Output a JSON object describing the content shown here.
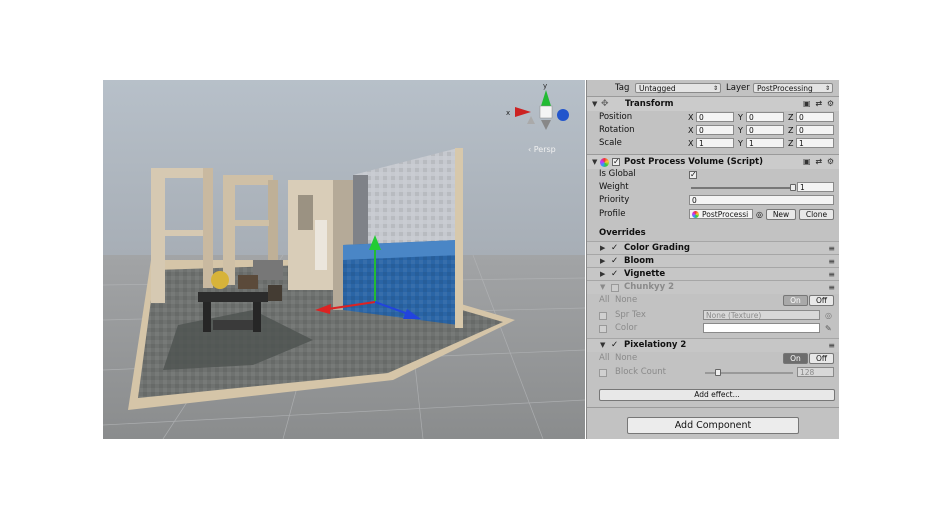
{
  "scene_view": {
    "gizmo": {
      "y_label": "y",
      "x_label": "x",
      "projection": "‹ Persp"
    },
    "colors": {
      "sky": "#aab4be",
      "ground": "#8e8e8e",
      "floor": "#6f7270",
      "wall": "#c9ccd2",
      "water": "#2a65a6"
    }
  },
  "inspector": {
    "tag_label": "Tag",
    "tag_value": "Untagged",
    "layer_label": "Layer",
    "layer_value": "PostProcessing",
    "transform": {
      "title": "Transform",
      "position_label": "Position",
      "rotation_label": "Rotation",
      "scale_label": "Scale",
      "axis_x": "X",
      "axis_y": "Y",
      "axis_z": "Z",
      "position": {
        "x": "0",
        "y": "0",
        "z": "0"
      },
      "rotation": {
        "x": "0",
        "y": "0",
        "z": "0"
      },
      "scale": {
        "x": "1",
        "y": "1",
        "z": "1"
      }
    },
    "ppv": {
      "title": "Post Process Volume (Script)",
      "is_global_label": "Is Global",
      "weight_label": "Weight",
      "weight_value": "1",
      "weight_fraction": 1,
      "priority_label": "Priority",
      "priority_value": "0",
      "profile_label": "Profile",
      "profile_value": "PostProcessi",
      "new_label": "New",
      "clone_label": "Clone",
      "overrides_label": "Overrides"
    },
    "effects": [
      {
        "name": "Color Grading"
      },
      {
        "name": "Bloom"
      },
      {
        "name": "Vignette"
      },
      {
        "name": "Chunkyy 2"
      },
      {
        "name": "Pixelationy 2"
      }
    ],
    "chunky": {
      "all_label": "All",
      "none_label": "None",
      "on_label": "On",
      "off_label": "Off",
      "spr_tex_label": "Spr Tex",
      "spr_tex_value": "None (Texture)",
      "color_label": "Color"
    },
    "pixelation": {
      "all_label": "All",
      "none_label": "None",
      "on_label": "On",
      "off_label": "Off",
      "block_count_label": "Block Count",
      "block_count_value": "128",
      "block_count_fraction": 0.15
    },
    "add_effect_label": "Add effect...",
    "add_component_label": "Add Component"
  }
}
